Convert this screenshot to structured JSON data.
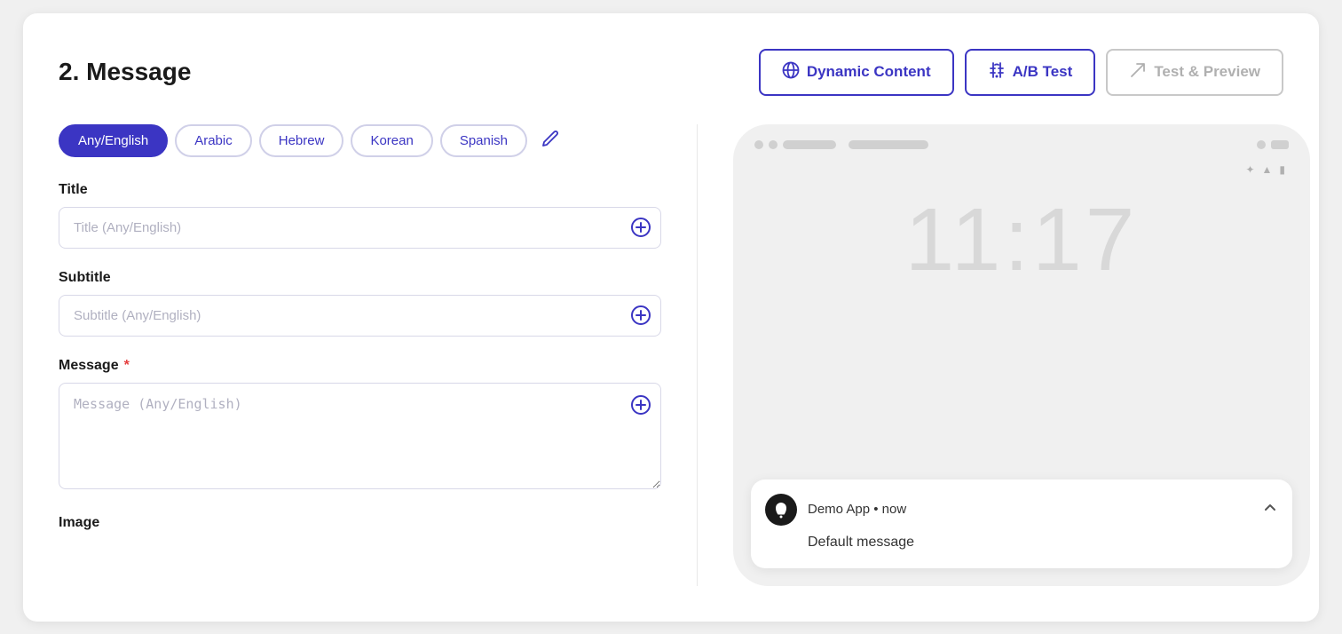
{
  "page": {
    "title": "2. Message"
  },
  "toolbar": {
    "dynamic_content_label": "Dynamic Content",
    "ab_test_label": "A/B Test",
    "test_preview_label": "Test & Preview",
    "dynamic_content_icon": "⊕",
    "ab_test_icon": "⚗",
    "test_preview_icon": "✈"
  },
  "languages": {
    "tabs": [
      {
        "id": "any_english",
        "label": "Any/English",
        "active": true
      },
      {
        "id": "arabic",
        "label": "Arabic",
        "active": false
      },
      {
        "id": "hebrew",
        "label": "Hebrew",
        "active": false
      },
      {
        "id": "korean",
        "label": "Korean",
        "active": false
      },
      {
        "id": "spanish",
        "label": "Spanish",
        "active": false
      }
    ],
    "edit_tooltip": "Edit languages"
  },
  "fields": {
    "title": {
      "label": "Title",
      "required": false,
      "placeholder": "Title (Any/English)"
    },
    "subtitle": {
      "label": "Subtitle",
      "required": false,
      "placeholder": "Subtitle (Any/English)"
    },
    "message": {
      "label": "Message",
      "required": true,
      "placeholder": "Message (Any/English)"
    },
    "image": {
      "label": "Image"
    }
  },
  "preview": {
    "time": "11:17",
    "app_name": "Demo App",
    "timestamp": "now",
    "message": "Default message"
  }
}
